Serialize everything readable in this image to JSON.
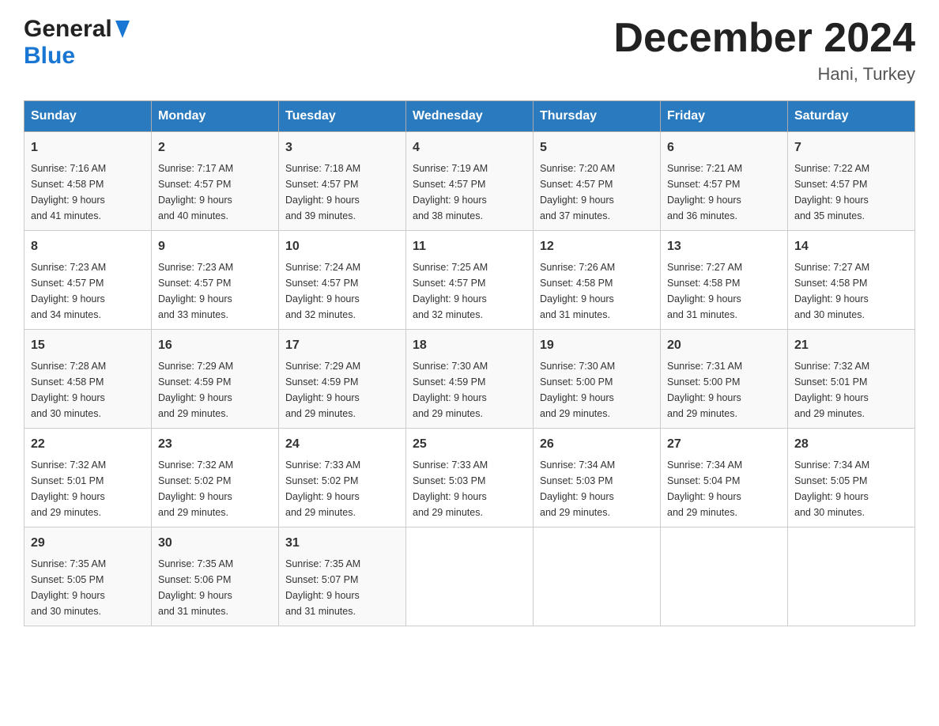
{
  "header": {
    "logo_general": "General",
    "logo_blue": "Blue",
    "month_title": "December 2024",
    "location": "Hani, Turkey"
  },
  "weekdays": [
    "Sunday",
    "Monday",
    "Tuesday",
    "Wednesday",
    "Thursday",
    "Friday",
    "Saturday"
  ],
  "weeks": [
    [
      {
        "day": "1",
        "sunrise": "7:16 AM",
        "sunset": "4:58 PM",
        "daylight": "9 hours and 41 minutes."
      },
      {
        "day": "2",
        "sunrise": "7:17 AM",
        "sunset": "4:57 PM",
        "daylight": "9 hours and 40 minutes."
      },
      {
        "day": "3",
        "sunrise": "7:18 AM",
        "sunset": "4:57 PM",
        "daylight": "9 hours and 39 minutes."
      },
      {
        "day": "4",
        "sunrise": "7:19 AM",
        "sunset": "4:57 PM",
        "daylight": "9 hours and 38 minutes."
      },
      {
        "day": "5",
        "sunrise": "7:20 AM",
        "sunset": "4:57 PM",
        "daylight": "9 hours and 37 minutes."
      },
      {
        "day": "6",
        "sunrise": "7:21 AM",
        "sunset": "4:57 PM",
        "daylight": "9 hours and 36 minutes."
      },
      {
        "day": "7",
        "sunrise": "7:22 AM",
        "sunset": "4:57 PM",
        "daylight": "9 hours and 35 minutes."
      }
    ],
    [
      {
        "day": "8",
        "sunrise": "7:23 AM",
        "sunset": "4:57 PM",
        "daylight": "9 hours and 34 minutes."
      },
      {
        "day": "9",
        "sunrise": "7:23 AM",
        "sunset": "4:57 PM",
        "daylight": "9 hours and 33 minutes."
      },
      {
        "day": "10",
        "sunrise": "7:24 AM",
        "sunset": "4:57 PM",
        "daylight": "9 hours and 32 minutes."
      },
      {
        "day": "11",
        "sunrise": "7:25 AM",
        "sunset": "4:57 PM",
        "daylight": "9 hours and 32 minutes."
      },
      {
        "day": "12",
        "sunrise": "7:26 AM",
        "sunset": "4:58 PM",
        "daylight": "9 hours and 31 minutes."
      },
      {
        "day": "13",
        "sunrise": "7:27 AM",
        "sunset": "4:58 PM",
        "daylight": "9 hours and 31 minutes."
      },
      {
        "day": "14",
        "sunrise": "7:27 AM",
        "sunset": "4:58 PM",
        "daylight": "9 hours and 30 minutes."
      }
    ],
    [
      {
        "day": "15",
        "sunrise": "7:28 AM",
        "sunset": "4:58 PM",
        "daylight": "9 hours and 30 minutes."
      },
      {
        "day": "16",
        "sunrise": "7:29 AM",
        "sunset": "4:59 PM",
        "daylight": "9 hours and 29 minutes."
      },
      {
        "day": "17",
        "sunrise": "7:29 AM",
        "sunset": "4:59 PM",
        "daylight": "9 hours and 29 minutes."
      },
      {
        "day": "18",
        "sunrise": "7:30 AM",
        "sunset": "4:59 PM",
        "daylight": "9 hours and 29 minutes."
      },
      {
        "day": "19",
        "sunrise": "7:30 AM",
        "sunset": "5:00 PM",
        "daylight": "9 hours and 29 minutes."
      },
      {
        "day": "20",
        "sunrise": "7:31 AM",
        "sunset": "5:00 PM",
        "daylight": "9 hours and 29 minutes."
      },
      {
        "day": "21",
        "sunrise": "7:32 AM",
        "sunset": "5:01 PM",
        "daylight": "9 hours and 29 minutes."
      }
    ],
    [
      {
        "day": "22",
        "sunrise": "7:32 AM",
        "sunset": "5:01 PM",
        "daylight": "9 hours and 29 minutes."
      },
      {
        "day": "23",
        "sunrise": "7:32 AM",
        "sunset": "5:02 PM",
        "daylight": "9 hours and 29 minutes."
      },
      {
        "day": "24",
        "sunrise": "7:33 AM",
        "sunset": "5:02 PM",
        "daylight": "9 hours and 29 minutes."
      },
      {
        "day": "25",
        "sunrise": "7:33 AM",
        "sunset": "5:03 PM",
        "daylight": "9 hours and 29 minutes."
      },
      {
        "day": "26",
        "sunrise": "7:34 AM",
        "sunset": "5:03 PM",
        "daylight": "9 hours and 29 minutes."
      },
      {
        "day": "27",
        "sunrise": "7:34 AM",
        "sunset": "5:04 PM",
        "daylight": "9 hours and 29 minutes."
      },
      {
        "day": "28",
        "sunrise": "7:34 AM",
        "sunset": "5:05 PM",
        "daylight": "9 hours and 30 minutes."
      }
    ],
    [
      {
        "day": "29",
        "sunrise": "7:35 AM",
        "sunset": "5:05 PM",
        "daylight": "9 hours and 30 minutes."
      },
      {
        "day": "30",
        "sunrise": "7:35 AM",
        "sunset": "5:06 PM",
        "daylight": "9 hours and 31 minutes."
      },
      {
        "day": "31",
        "sunrise": "7:35 AM",
        "sunset": "5:07 PM",
        "daylight": "9 hours and 31 minutes."
      },
      null,
      null,
      null,
      null
    ]
  ],
  "labels": {
    "sunrise": "Sunrise: ",
    "sunset": "Sunset: ",
    "daylight": "Daylight: "
  }
}
